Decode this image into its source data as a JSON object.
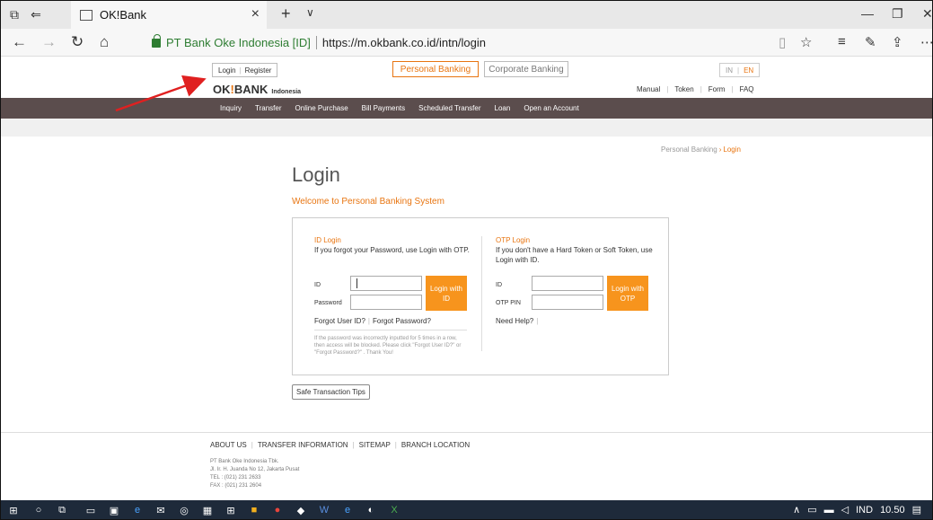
{
  "browser": {
    "tab_title": "OK!Bank",
    "tab_close": "×",
    "new_tab": "+",
    "tab_menu": "∨",
    "org_label": "PT Bank Oke Indonesia [ID]",
    "url": "https://m.okbank.co.id/intn/login"
  },
  "header": {
    "login_label": "Login",
    "register_label": "Register",
    "tabs": {
      "personal": "Personal Banking",
      "corporate": "Corporate Banking"
    },
    "lang": {
      "in": "IN",
      "en": "EN"
    },
    "logo": {
      "name_a": "OK",
      "name_bang": "!",
      "name_b": "BANK",
      "sub": "Indonesia"
    },
    "util": [
      "Manual",
      "Token",
      "Form",
      "FAQ"
    ]
  },
  "menu": [
    "Inquiry",
    "Transfer",
    "Online Purchase",
    "Bill Payments",
    "Scheduled Transfer",
    "Loan",
    "Open an Account"
  ],
  "breadcrumb": {
    "parent": "Personal Banking",
    "arrow": "›",
    "current": "Login"
  },
  "main": {
    "title": "Login",
    "welcome": "Welcome to Personal Banking System",
    "id_login": {
      "title": "ID Login",
      "desc": "If you forgot your Password, use Login with OTP.",
      "id_label": "ID",
      "password_label": "Password",
      "button": "Login with ID",
      "forgot_user": "Forgot User ID?",
      "forgot_password": "Forgot Password?",
      "note": "If the password was incorrectly inputted for 5 times in a row, then access will be blocked. Please click \"Forgot User ID?\" or \"Forgot Password?\" . Thank You!"
    },
    "otp_login": {
      "title": "OTP Login",
      "desc": "If you don't have a Hard Token or Soft Token, use Login with ID.",
      "id_label": "ID",
      "pin_label": "OTP PIN",
      "button": "Login with OTP",
      "help": "Need Help?"
    },
    "tips_button": "Safe Transaction Tips"
  },
  "footer": {
    "links": [
      "ABOUT US",
      "TRANSFER INFORMATION",
      "SITEMAP",
      "BRANCH LOCATION"
    ],
    "company": "PT Bank Oke Indonesia Tbk.",
    "address": "Jl. Ir. H. Juanda No 12, Jakarta Pusat",
    "tel": "TEL : (021) 231 2633",
    "fax": "FAX : (021) 231 2604"
  },
  "taskbar": {
    "lang": "IND",
    "time": "10.50"
  },
  "colors": {
    "accent": "#e87511",
    "button": "#f7941d",
    "menu_bg": "#5b4d4d",
    "secure": "#2e7d32",
    "annotation": "#e02020"
  }
}
